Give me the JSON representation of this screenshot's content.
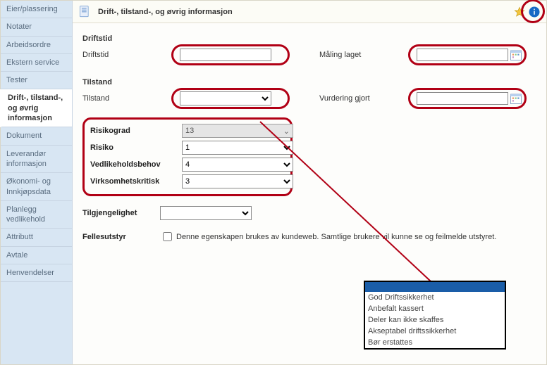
{
  "sidebar": {
    "items": [
      {
        "label": "Eier/plassering"
      },
      {
        "label": "Notater"
      },
      {
        "label": "Arbeidsordre"
      },
      {
        "label": "Ekstern service"
      },
      {
        "label": "Tester"
      },
      {
        "label": "Drift-, tilstand-, og øvrig informasjon",
        "active": true
      },
      {
        "label": "Dokument"
      },
      {
        "label": "Leverandør informasjon"
      },
      {
        "label": "Økonomi- og Innkjøpsdata"
      },
      {
        "label": "Planlegg vedlikehold"
      },
      {
        "label": "Attributt"
      },
      {
        "label": "Avtale"
      },
      {
        "label": "Henvendelser"
      }
    ]
  },
  "header": {
    "title": "Drift-, tilstand-, og øvrig informasjon"
  },
  "sections": {
    "driftstid": {
      "title": "Driftstid",
      "left_label": "Driftstid",
      "left_value": "",
      "right_label": "Måling laget",
      "right_value": ""
    },
    "tilstand": {
      "title": "Tilstand",
      "left_label": "Tilstand",
      "left_value": "",
      "right_label": "Vurdering gjort",
      "right_value": ""
    }
  },
  "risk": {
    "risikograd_label": "Risikograd",
    "risikograd_value": "13",
    "risiko_label": "Risiko",
    "risiko_value": "1",
    "vedlikehold_label": "Vedlikeholdsbehov",
    "vedlikehold_value": "4",
    "virksomhet_label": "Virksomhetskritisk",
    "virksomhet_value": "3"
  },
  "lower": {
    "tilgjengelighet_label": "Tilgjengelighet",
    "tilgjengelighet_value": "",
    "fellesutstyr_label": "Fellesutstyr",
    "fellesutstyr_desc": "Denne egenskapen brukes av kundeweb. Samtlige brukere vil kunne se og feilmelde utstyret."
  },
  "popup": {
    "options": [
      "God Driftssikkerhet",
      "Anbefalt kassert",
      "Deler kan ikke skaffes",
      "Akseptabel driftssikkerhet",
      "Bør erstattes"
    ]
  }
}
